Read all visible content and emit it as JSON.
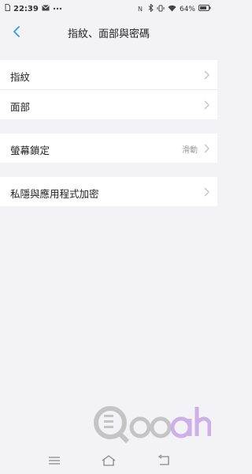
{
  "status_bar": {
    "time": "22:39",
    "notification_icons": [
      "sim-card-icon",
      "mail-icon",
      "more-dots-icon"
    ],
    "system_icons": [
      "nfc-icon",
      "bluetooth-icon",
      "vibrate-icon",
      "wifi-icon"
    ],
    "battery": "64%"
  },
  "header": {
    "title": "指紋、面部與密碼",
    "back_icon": "chevron-left-icon"
  },
  "groups": [
    {
      "items": [
        {
          "label": "指紋"
        },
        {
          "label": "面部"
        }
      ]
    },
    {
      "items": [
        {
          "label": "螢幕鎖定",
          "value": "滑動"
        }
      ]
    },
    {
      "items": [
        {
          "label": "私隱與應用程式加密"
        }
      ]
    }
  ],
  "watermark": {
    "text": "Qooah"
  },
  "colors": {
    "accent": "#2fa0d8",
    "background": "#f3f3f5",
    "watermark_gray": "#bdbdbd",
    "watermark_purple": "#c9a9e6"
  },
  "nav_bar": {
    "icons": [
      "menu-icon",
      "home-icon",
      "back-icon"
    ]
  }
}
